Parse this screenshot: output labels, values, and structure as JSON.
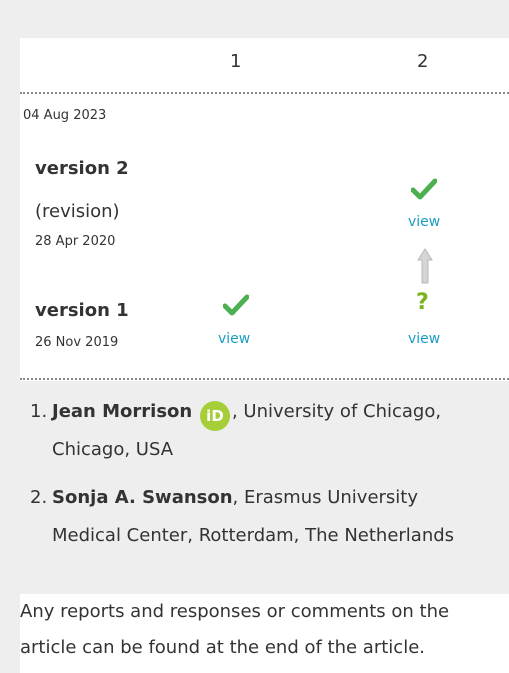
{
  "table": {
    "col_headers": [
      "1",
      "2"
    ],
    "top_date": "04 Aug 2023",
    "versions": [
      {
        "title": "version 2",
        "subtitle": "(revision)",
        "date": "28 Apr 2020",
        "reviewer_2": {
          "status": "approved",
          "link": "view"
        }
      },
      {
        "title": "version 1",
        "subtitle": "",
        "date": "26 Nov 2019",
        "reviewer_1": {
          "status": "approved",
          "link": "view"
        },
        "reviewer_2": {
          "status": "question",
          "link": "view"
        }
      }
    ],
    "question_mark": "?"
  },
  "authors": [
    {
      "num": "1.",
      "name": "Jean Morrison",
      "orcid": "iD",
      "affil_1": ", University of Chicago,",
      "affil_2": "Chicago, USA"
    },
    {
      "num": "2.",
      "name": "Sonja A. Swanson",
      "affil_1": ", Erasmus University",
      "affil_2": "Medical Center, Rotterdam, The Netherlands"
    }
  ],
  "footer": {
    "line1": "Any reports and responses or comments on the",
    "line2": "article can be found at the end of the article."
  },
  "colors": {
    "approved": "#4caf50",
    "question": "#7ab317",
    "link": "#1a9ec4",
    "orcid": "#a6ce39"
  }
}
